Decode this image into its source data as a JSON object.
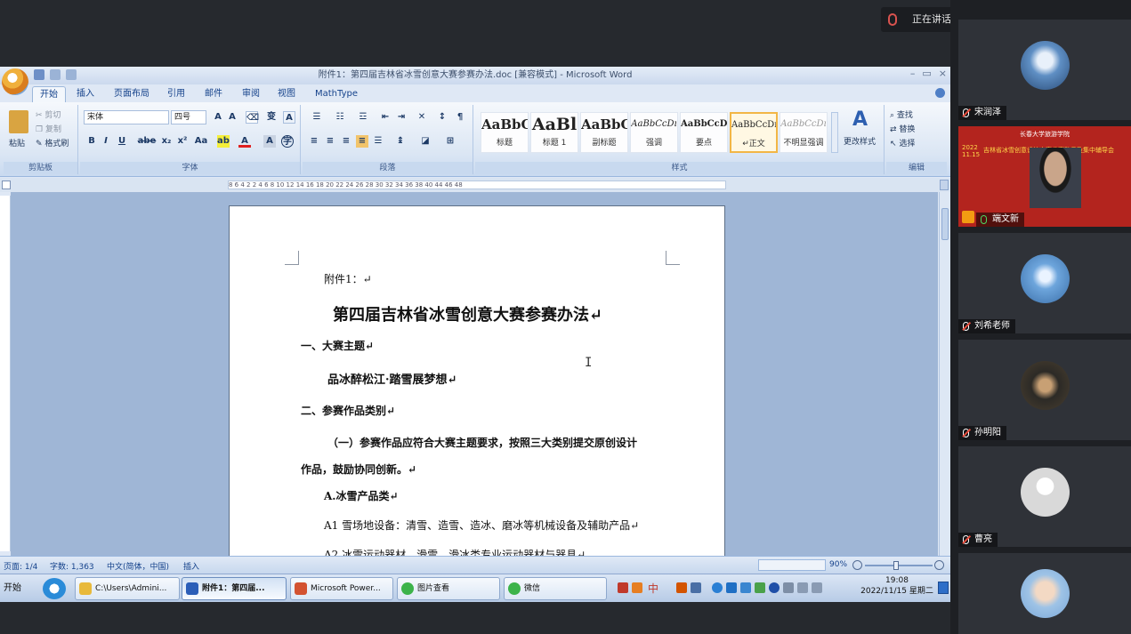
{
  "meeting": {
    "speaking_label": "正在讲话: 端文新;"
  },
  "word": {
    "title": "附件1：第四届吉林省冰雪创意大赛参赛办法.doc [兼容模式] - Microsoft Word",
    "tabs": [
      "开始",
      "插入",
      "页面布局",
      "引用",
      "邮件",
      "审阅",
      "视图",
      "MathType"
    ],
    "active_tab": "开始",
    "clipboard": {
      "paste": "粘贴",
      "cut": "剪切",
      "copy": "复制",
      "format_painter": "格式刷",
      "label": "剪贴板"
    },
    "font": {
      "name": "宋体",
      "size": "四号",
      "label": "字体"
    },
    "paragraph": {
      "label": "段落"
    },
    "styles": {
      "label": "样式",
      "items": [
        {
          "sample": "AaBbC",
          "name": "标题"
        },
        {
          "sample": "AaBl",
          "name": "标题 1"
        },
        {
          "sample": "AaBbC",
          "name": "副标题"
        },
        {
          "sample": "AaBbCcDı",
          "name": "强调"
        },
        {
          "sample": "AaBbCcD",
          "name": "要点"
        },
        {
          "sample": "AaBbCcDı",
          "name": "↵正文"
        },
        {
          "sample": "AaBbCcDı",
          "name": "不明显强调"
        }
      ],
      "change_styles": "更改样式"
    },
    "editing": {
      "find": "查找",
      "replace": "替换",
      "select": "选择",
      "label": "编辑"
    },
    "ruler_ticks": "8  6  4  2     2  4  6  8  10  12  14  16  18  20  22  24  26  28  30  32  34  36  38  40     44  46  48",
    "document": {
      "attachment": "附件1：↵",
      "title": "第四届吉林省冰雪创意大赛参赛办法↵",
      "h1": "一、大赛主题↵",
      "theme": "品冰醉松江·踏雪展梦想↵",
      "h2": "二、参赛作品类别↵",
      "p1a": "（一）参赛作品应符合大赛主题要求，按照三大类别提交原创设计",
      "p1b": "作品，鼓励协同创新。↵",
      "a_cat": "A.冰雪产品类↵",
      "a1": "A1 雪场地设备：清雪、造雪、造冰、磨冰等机械设备及辅助产品↵",
      "a2": "A2 冰雪运动器材，滑雪、滑冰类专业运动器材与器具↵"
    },
    "status": {
      "page": "页面: 1/4",
      "words": "字数: 1,363",
      "language": "中文(简体，中国)",
      "mode": "插入",
      "zoom": "90%"
    }
  },
  "taskbar": {
    "start": "开始",
    "tasks": [
      {
        "label": "C:\\Users\\Admini...",
        "color": "#e8b93b",
        "active": false
      },
      {
        "label": "附件1：第四届...",
        "color": "#2b5eb8",
        "active": true
      },
      {
        "label": "Microsoft Power...",
        "color": "#d35230",
        "active": false
      },
      {
        "label": "图片查看",
        "color": "#3cb34a",
        "active": false
      },
      {
        "label": "微信",
        "color": "#3cb34a",
        "active": false
      }
    ],
    "ime": "中",
    "time": "19:08",
    "date": "2022/11/15 星期二"
  },
  "participants": [
    {
      "name": "宋润泽",
      "avatar": "#5f8fc4",
      "muted": true
    },
    {
      "name": "端文新",
      "avatar": "#c0392b",
      "muted": false,
      "video": true,
      "banner": "吉林省冰雪创意设计大赛参赛动员及集中辅导会",
      "banner_org": "长春大学旅游学院",
      "banner_date": "2022 11.15"
    },
    {
      "name": "刘希老师",
      "avatar": "#6da5dc",
      "muted": true
    },
    {
      "name": "孙明阳",
      "avatar": "#2c2a26",
      "muted": true
    },
    {
      "name": "曹亮",
      "avatar": "#d9d9d9",
      "muted": true
    },
    {
      "name": "",
      "avatar": "#9ec3e6",
      "muted": true
    }
  ],
  "colors": {
    "ribbon_accent": "#15428b",
    "page_bg": "#9fb6d6"
  }
}
